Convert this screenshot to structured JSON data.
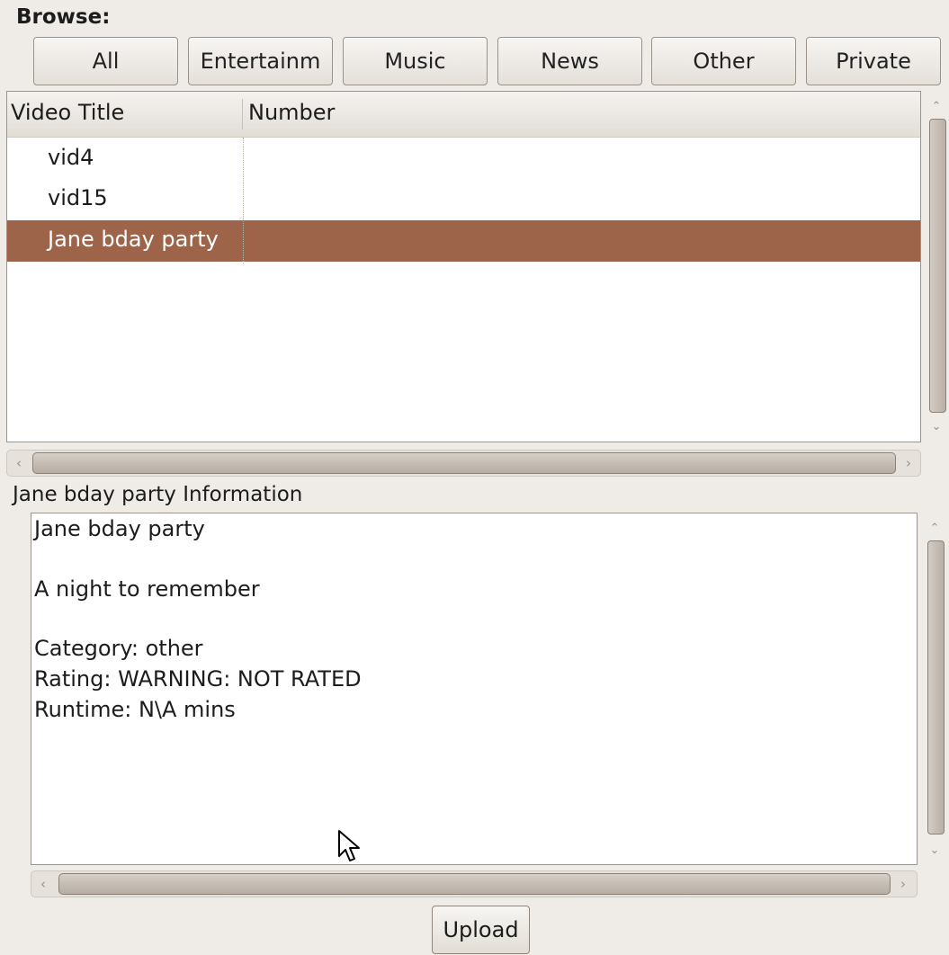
{
  "browse": {
    "label": "Browse:"
  },
  "categories": [
    "All",
    "Entertainm",
    "Music",
    "News",
    "Other",
    "Private"
  ],
  "video_list": {
    "columns": {
      "title": "Video Title",
      "number": "Number"
    },
    "rows": [
      {
        "title": "vid4",
        "number": ""
      },
      {
        "title": "vid15",
        "number": ""
      },
      {
        "title": "Jane bday party",
        "number": ""
      }
    ],
    "selected_index": 2
  },
  "info": {
    "heading": "Jane bday party  Information",
    "title": "Jane bday party",
    "description": "A night to remember",
    "category": "Category: other",
    "rating": "Rating: WARNING: NOT RATED",
    "runtime": "Runtime: N\\A mins"
  },
  "upload": {
    "label": "Upload"
  },
  "icons": {
    "scroll_up": "chevron-up-icon",
    "scroll_down": "chevron-down-icon",
    "scroll_left": "chevron-left-icon",
    "scroll_right": "chevron-right-icon",
    "cursor": "mouse-pointer-icon"
  },
  "colors": {
    "selection": "#9d6449",
    "background": "#efebe7"
  }
}
